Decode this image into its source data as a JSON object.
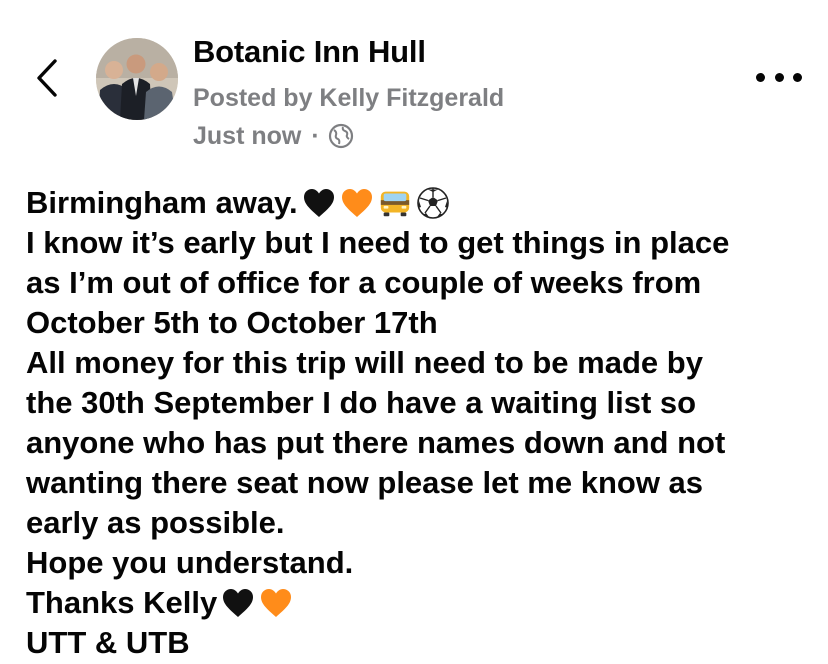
{
  "header": {
    "page_name": "Botanic Inn Hull",
    "posted_by": "Posted by Kelly Fitzgerald",
    "time": "Just now",
    "separator": "·",
    "back_icon": "chevron-left-icon",
    "audience_icon": "globe-icon",
    "more_icon": "more-horizontal-icon"
  },
  "post": {
    "line_1": "Birmingham away.",
    "line_1_emojis": [
      "black-heart-icon",
      "orange-heart-icon",
      "bus-icon",
      "soccer-ball-icon"
    ],
    "line_2": "I know it’s early but I need to get things in place",
    "line_3": "as I’m out of office for a couple of weeks from",
    "line_4": "October 5th to October 17th",
    "line_5": "All money for this trip will need to be made by",
    "line_6": "the 30th September I do have a waiting list so",
    "line_7": "anyone who has put there names down and not",
    "line_8": "wanting there seat now please let me know as",
    "line_9": "early as possible.",
    "line_10": "Hope you understand.",
    "line_11": "Thanks Kelly",
    "line_11_emojis": [
      "black-heart-icon",
      "orange-heart-icon"
    ],
    "line_12": "UTT & UTB"
  },
  "colors": {
    "text": "#050505",
    "meta_text": "#7e7f82",
    "black_heart": "#111111",
    "orange_heart": "#ff8c1a",
    "background": "#ffffff"
  }
}
